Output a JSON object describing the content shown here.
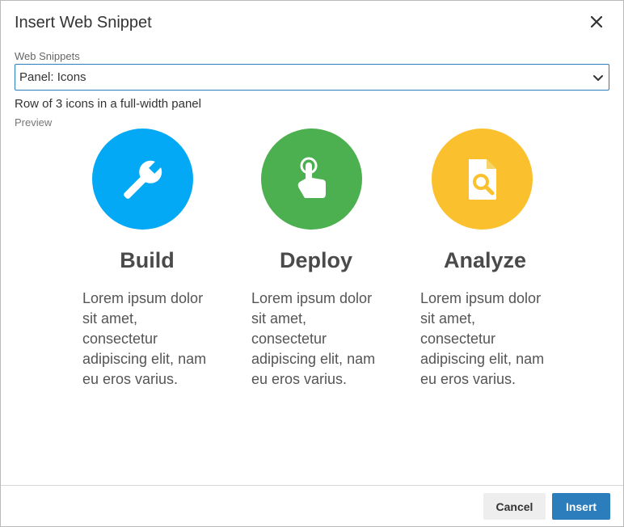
{
  "dialog": {
    "title": "Insert Web Snippet",
    "close_icon": "close-icon"
  },
  "snippet_field": {
    "label": "Web Snippets",
    "selected": "Panel: Icons",
    "description": "Row of 3 icons in a full-width panel"
  },
  "preview": {
    "label": "Preview",
    "columns": [
      {
        "icon": "wrench-icon",
        "color": "#03a9f4",
        "heading": "Build",
        "text": "Lorem ipsum dolor sit amet, consectetur adipiscing elit, nam eu eros varius."
      },
      {
        "icon": "touch-icon",
        "color": "#4caf50",
        "heading": "Deploy",
        "text": "Lorem ipsum dolor sit amet, consectetur adipiscing elit, nam eu eros varius."
      },
      {
        "icon": "file-search-icon",
        "color": "#fbc02d",
        "heading": "Analyze",
        "text": "Lorem ipsum dolor sit amet, consectetur adipiscing elit, nam eu eros varius."
      }
    ]
  },
  "footer": {
    "cancel_label": "Cancel",
    "insert_label": "Insert"
  }
}
